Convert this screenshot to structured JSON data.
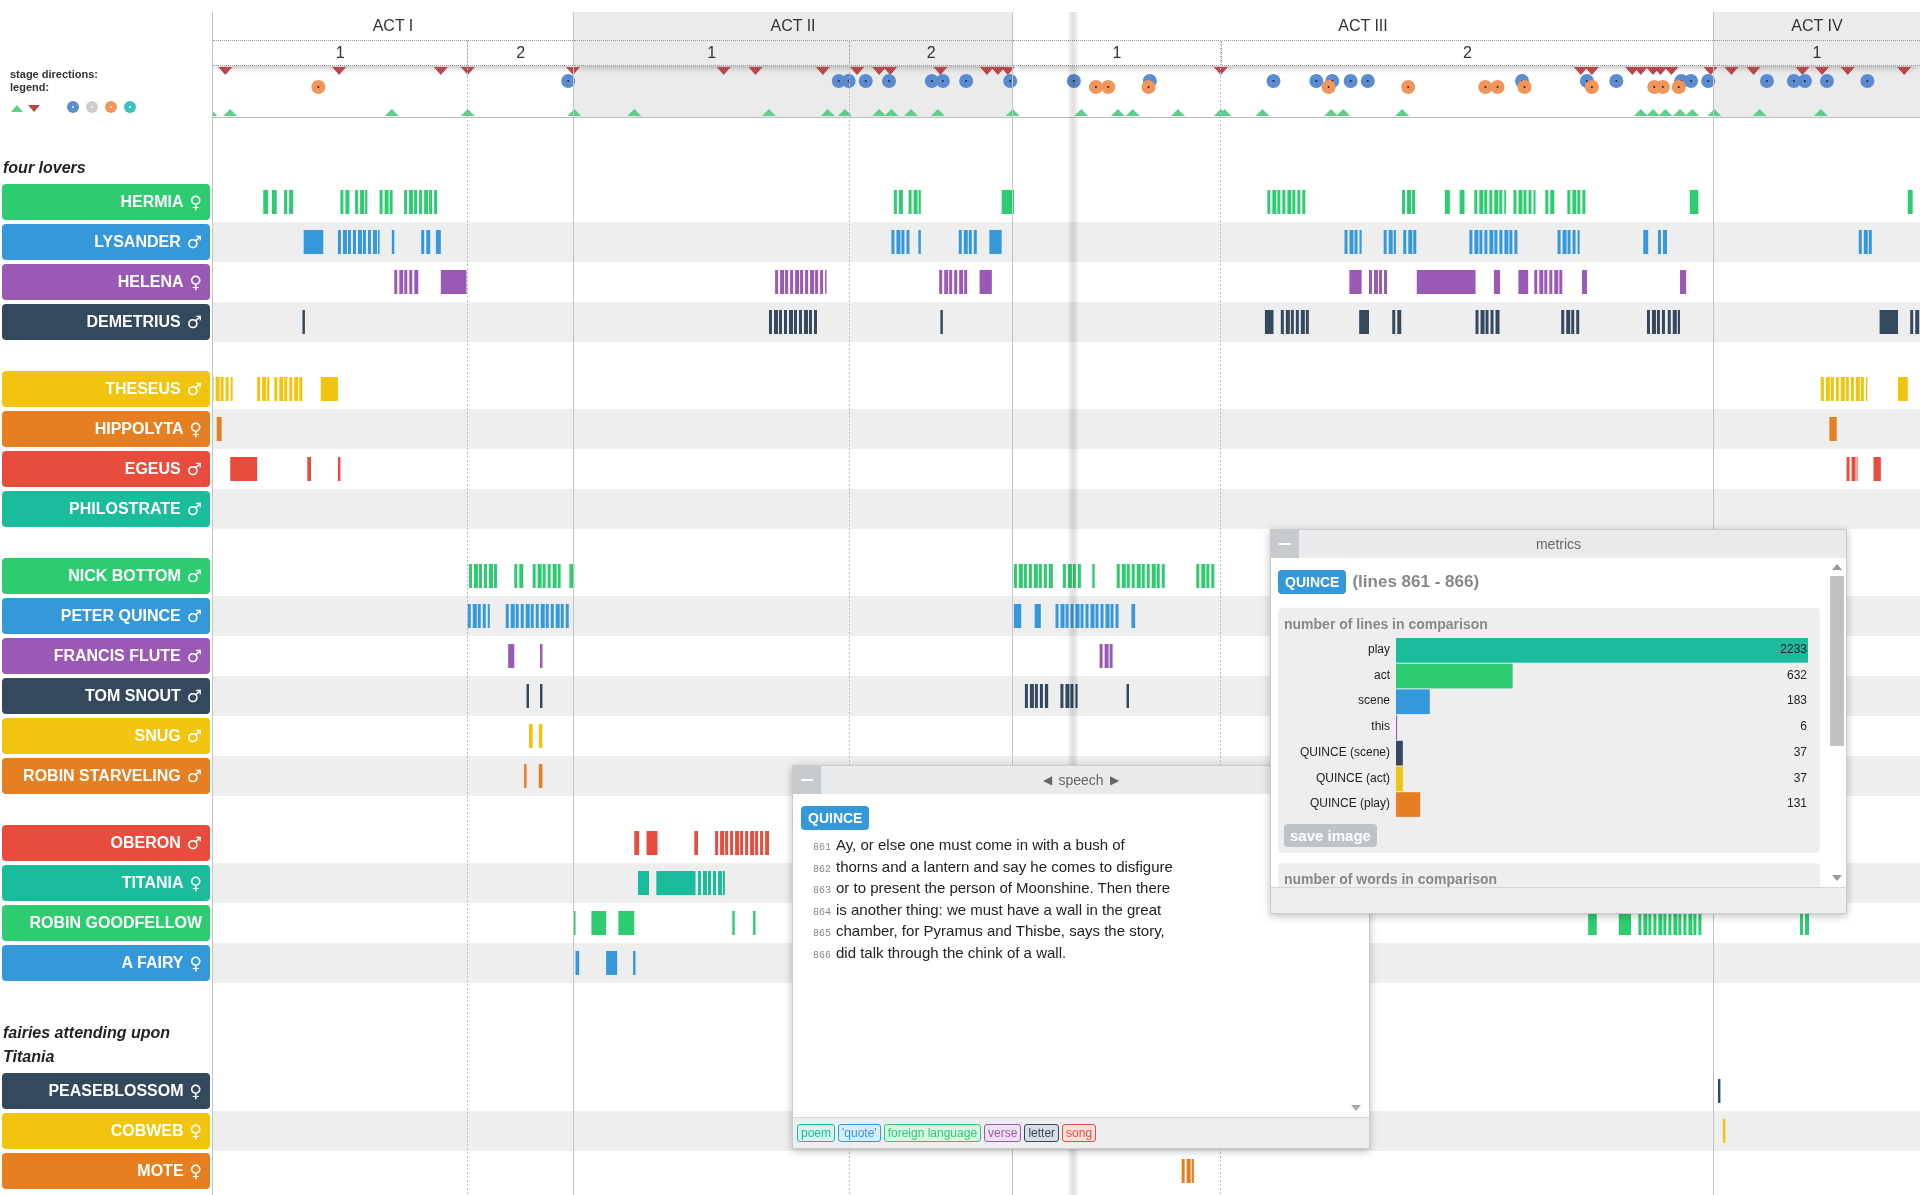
{
  "header": {
    "acts": [
      {
        "label": "ACT I",
        "scenes": [
          "1",
          "2"
        ]
      },
      {
        "label": "ACT II",
        "scenes": [
          "1",
          "2"
        ]
      },
      {
        "label": "ACT III",
        "scenes": [
          "1",
          "2"
        ]
      },
      {
        "label": "ACT IV",
        "scenes": [
          "1"
        ]
      }
    ],
    "stage_directions_label": "stage directions:",
    "legend_label": "legend:"
  },
  "groups": [
    {
      "label": "four lovers",
      "characters": [
        {
          "name": "HERMIA",
          "symbol": "♀",
          "color": "#2ecc71"
        },
        {
          "name": "LYSANDER",
          "symbol": "♂",
          "color": "#3498db"
        },
        {
          "name": "HELENA",
          "symbol": "♀",
          "color": "#9b59b6"
        },
        {
          "name": "DEMETRIUS",
          "symbol": "♂",
          "color": "#34495e"
        }
      ]
    },
    {
      "characters": [
        {
          "name": "THESEUS",
          "symbol": "♂",
          "color": "#f1c40f"
        },
        {
          "name": "HIPPOLYTA",
          "symbol": "♀",
          "color": "#e67e22"
        },
        {
          "name": "EGEUS",
          "symbol": "♂",
          "color": "#e74c3c"
        },
        {
          "name": "PHILOSTRATE",
          "symbol": "♂",
          "color": "#1abc9c"
        }
      ]
    },
    {
      "characters": [
        {
          "name": "NICK BOTTOM",
          "symbol": "♂",
          "color": "#2ecc71"
        },
        {
          "name": "PETER QUINCE",
          "symbol": "♂",
          "color": "#3498db"
        },
        {
          "name": "FRANCIS FLUTE",
          "symbol": "♂",
          "color": "#9b59b6"
        },
        {
          "name": "TOM SNOUT",
          "symbol": "♂",
          "color": "#34495e"
        },
        {
          "name": "SNUG",
          "symbol": "♂",
          "color": "#f1c40f"
        },
        {
          "name": "ROBIN STARVELING",
          "symbol": "♂",
          "color": "#e67e22"
        }
      ]
    },
    {
      "characters": [
        {
          "name": "OBERON",
          "symbol": "♂",
          "color": "#e74c3c"
        },
        {
          "name": "TITANIA",
          "symbol": "♀",
          "color": "#1abc9c"
        },
        {
          "name": "ROBIN GOODFELLOW",
          "color": "#2ecc71"
        },
        {
          "name": "A FAIRY",
          "symbol": "♀",
          "color": "#3498db"
        }
      ]
    },
    {
      "label": "fairies attending upon Titania",
      "characters": [
        {
          "name": "PEASEBLOSSOM",
          "symbol": "♀",
          "color": "#34495e"
        },
        {
          "name": "COBWEB",
          "symbol": "♀",
          "color": "#f1c40f"
        },
        {
          "name": "MOTE",
          "symbol": "♀",
          "color": "#e67e22"
        }
      ]
    }
  ],
  "speech_panel": {
    "title": "speech",
    "prev": "◀",
    "next": "▶",
    "speaker": "QUINCE",
    "lines": [
      {
        "number": "861",
        "text": "Ay, or else one must come in with a bush of"
      },
      {
        "number": "862",
        "text": "thorns and a lantern and say he comes to disfigure"
      },
      {
        "number": "863",
        "text": "or to present the person of Moonshine. Then there"
      },
      {
        "number": "864",
        "text": "is another thing: we must have a wall in the great"
      },
      {
        "number": "865",
        "text": "chamber, for Pyramus and Thisbe, says the story,"
      },
      {
        "number": "866",
        "text": "did talk through the chink of a wall."
      }
    ],
    "tags": [
      {
        "label": "poem",
        "color": "#1abc9c"
      },
      {
        "label": "'quote'",
        "color": "#3498db"
      },
      {
        "label": "foreign language",
        "color": "#2ecc71"
      },
      {
        "label": "verse",
        "color": "#9b59b6"
      },
      {
        "label": "letter",
        "color": "#34495e"
      },
      {
        "label": "song",
        "color": "#e74c3c"
      }
    ]
  },
  "metrics_panel": {
    "title": "metrics",
    "speaker": "QUINCE",
    "range": "(lines 861 - 866)",
    "sections": [
      {
        "title": "number of lines in comparison",
        "button": "save image",
        "chart_data": {
          "type": "bar",
          "orientation": "horizontal",
          "categories": [
            "play",
            "act",
            "scene",
            "this",
            "QUINCE (scene)",
            "QUINCE (act)",
            "QUINCE (play)"
          ],
          "values": [
            2233,
            632,
            183,
            6,
            37,
            37,
            131
          ],
          "data_labels": true
        }
      },
      {
        "title": "number of words in comparison"
      }
    ]
  }
}
